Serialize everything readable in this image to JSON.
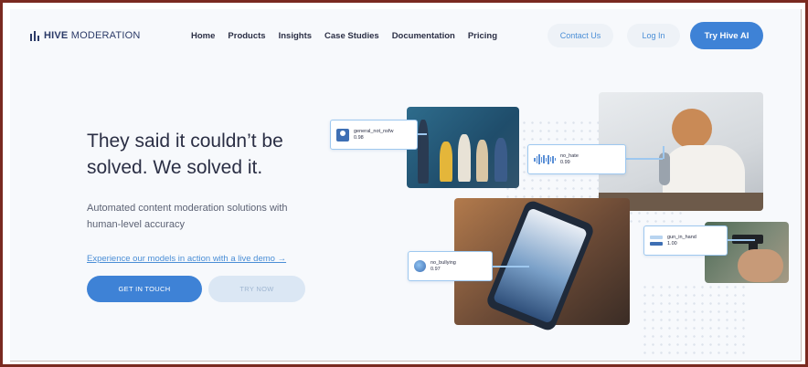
{
  "brand": {
    "name_bold": "HIVE",
    "name_rest": " MODERATION"
  },
  "nav": {
    "items": [
      "Home",
      "Products",
      "Insights",
      "Case Studies",
      "Documentation",
      "Pricing"
    ]
  },
  "header_actions": {
    "contact": "Contact Us",
    "login": "Log In",
    "try": "Try Hive AI"
  },
  "hero": {
    "headline_line1": "They said it couldn’t be",
    "headline_line2": "solved. We solved it.",
    "subtitle_line1": "Automated content moderation solutions with",
    "subtitle_line2": "human-level accuracy",
    "demo_link": "Experience our models in action with a live demo →",
    "cta_primary": "GET IN TOUCH",
    "cta_secondary": "TRY NOW"
  },
  "tags": [
    {
      "name": "general_not_nsfw",
      "score": "0.98",
      "icon": "user-icon"
    },
    {
      "name": "no_hate",
      "score": "0.99",
      "icon": "audio-wave-icon"
    },
    {
      "name": "gun_in_hand",
      "score": "1.00",
      "icon": "bars-icon"
    },
    {
      "name": "no_bullying",
      "score": "0.97",
      "icon": "circle-icon"
    }
  ],
  "colors": {
    "accent": "#3e82d6",
    "text_dark": "#2b2f45",
    "tag_border": "#9ec8ef",
    "frame": "#7a2a20"
  }
}
